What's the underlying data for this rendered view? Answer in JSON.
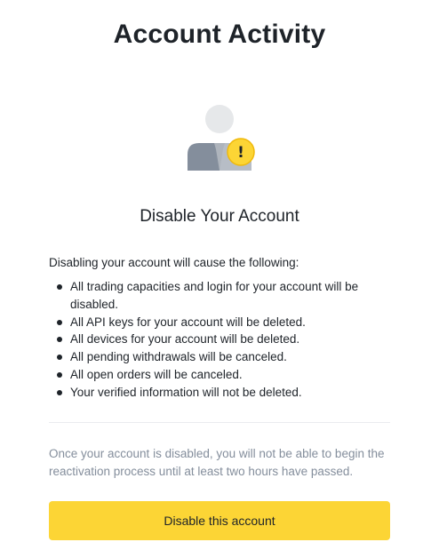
{
  "page": {
    "title": "Account Activity"
  },
  "illustration": {
    "icon": "user-warning-icon",
    "badge_glyph": "!",
    "colors": {
      "head": "#e6e8ea",
      "body": "#848e9c",
      "badge": "#f0b90b"
    }
  },
  "section": {
    "title": "Disable Your Account",
    "intro": "Disabling your account will cause the following:",
    "items": [
      "All trading capacities and login for your account will be disabled.",
      "All API keys for your account will be deleted.",
      "All devices for your account will be deleted.",
      "All pending withdrawals will be canceled.",
      "All open orders will be canceled.",
      "Your verified information will not be deleted."
    ]
  },
  "notice": {
    "text": "Once your account is disabled, you will not be able to begin the reactivation process until at least two hours have passed."
  },
  "actions": {
    "disable_label": "Disable this account"
  },
  "colors": {
    "accent": "#fcd535",
    "text": "#1e2329",
    "muted": "#848e9c"
  }
}
